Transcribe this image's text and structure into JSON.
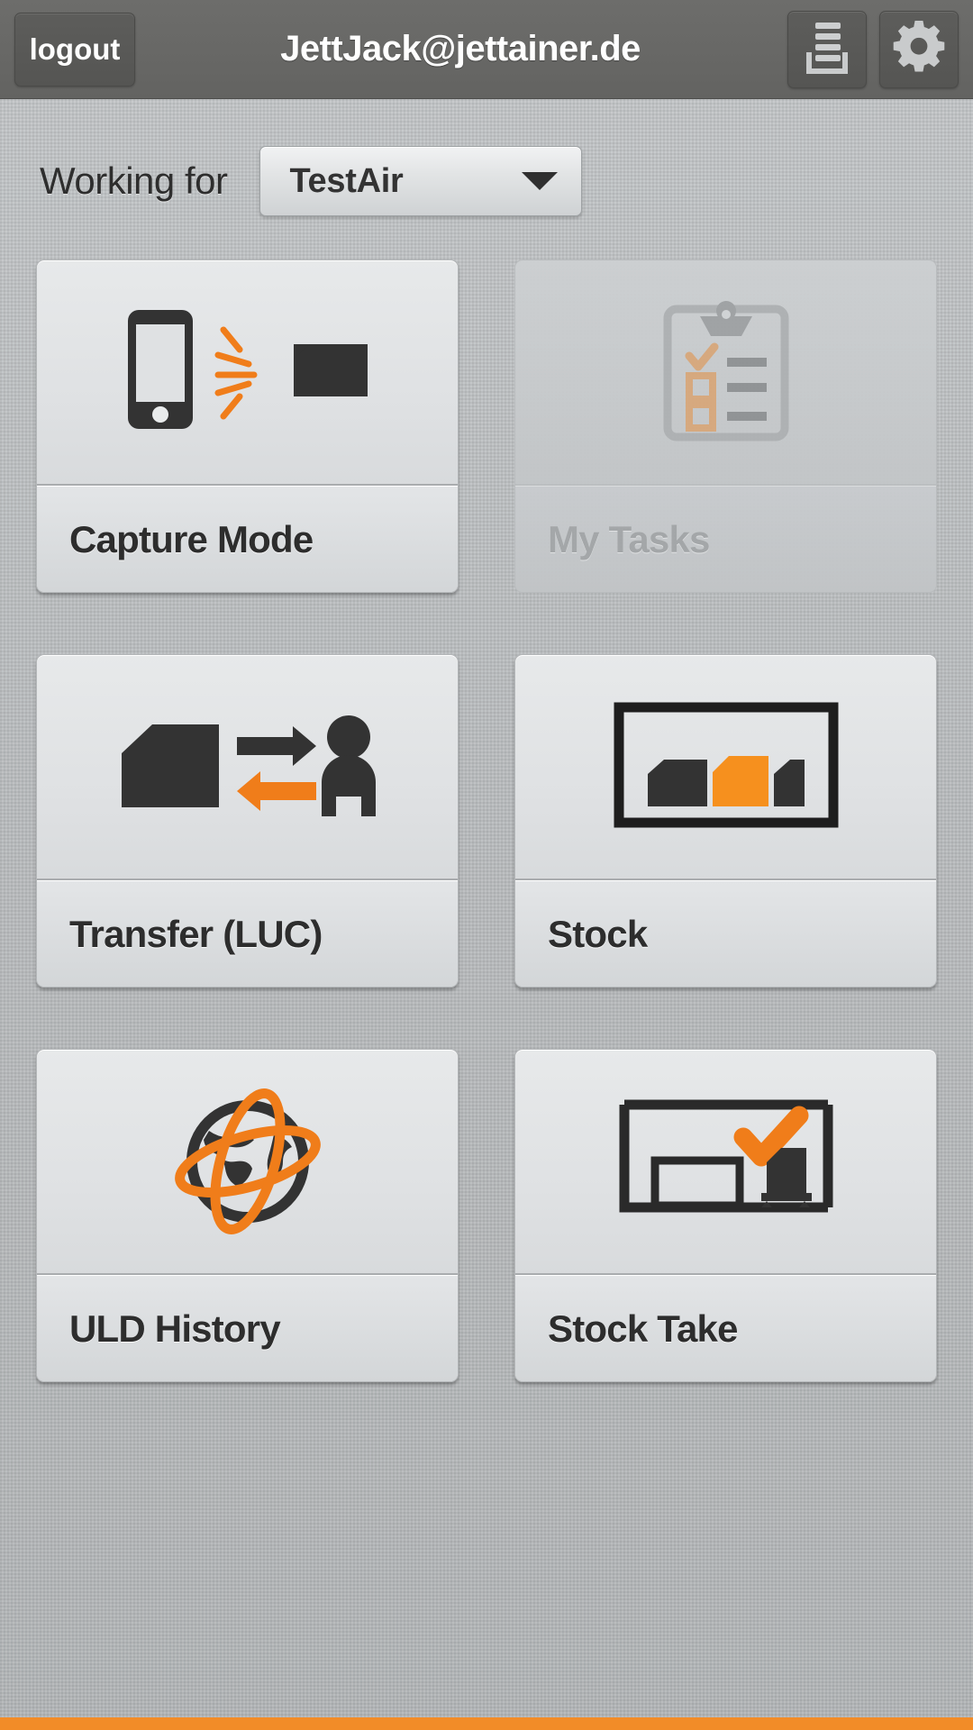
{
  "header": {
    "logout_label": "logout",
    "user_email": "JettJack@jettainer.de",
    "list_icon": "list-document-icon",
    "settings_icon": "gear-icon"
  },
  "working_for": {
    "label": "Working for",
    "selected": "TestAir",
    "caret_icon": "chevron-down-icon"
  },
  "tiles": [
    {
      "label": "Capture Mode",
      "icon": "phone-scan-uld-icon",
      "enabled": true
    },
    {
      "label": "My Tasks",
      "icon": "clipboard-checklist-icon",
      "enabled": false
    },
    {
      "label": "Transfer (LUC)",
      "icon": "uld-transfer-person-icon",
      "enabled": true
    },
    {
      "label": "Stock",
      "icon": "uld-stock-rack-icon",
      "enabled": true
    },
    {
      "label": "ULD History",
      "icon": "globe-orbit-icon",
      "enabled": true
    },
    {
      "label": "Stock Take",
      "icon": "warehouse-check-dolly-icon",
      "enabled": true
    }
  ],
  "colors": {
    "accent_orange": "#f28c28",
    "header_grey": "#686866",
    "icon_dark": "#333333",
    "disabled_grey": "#a3a6a8"
  }
}
